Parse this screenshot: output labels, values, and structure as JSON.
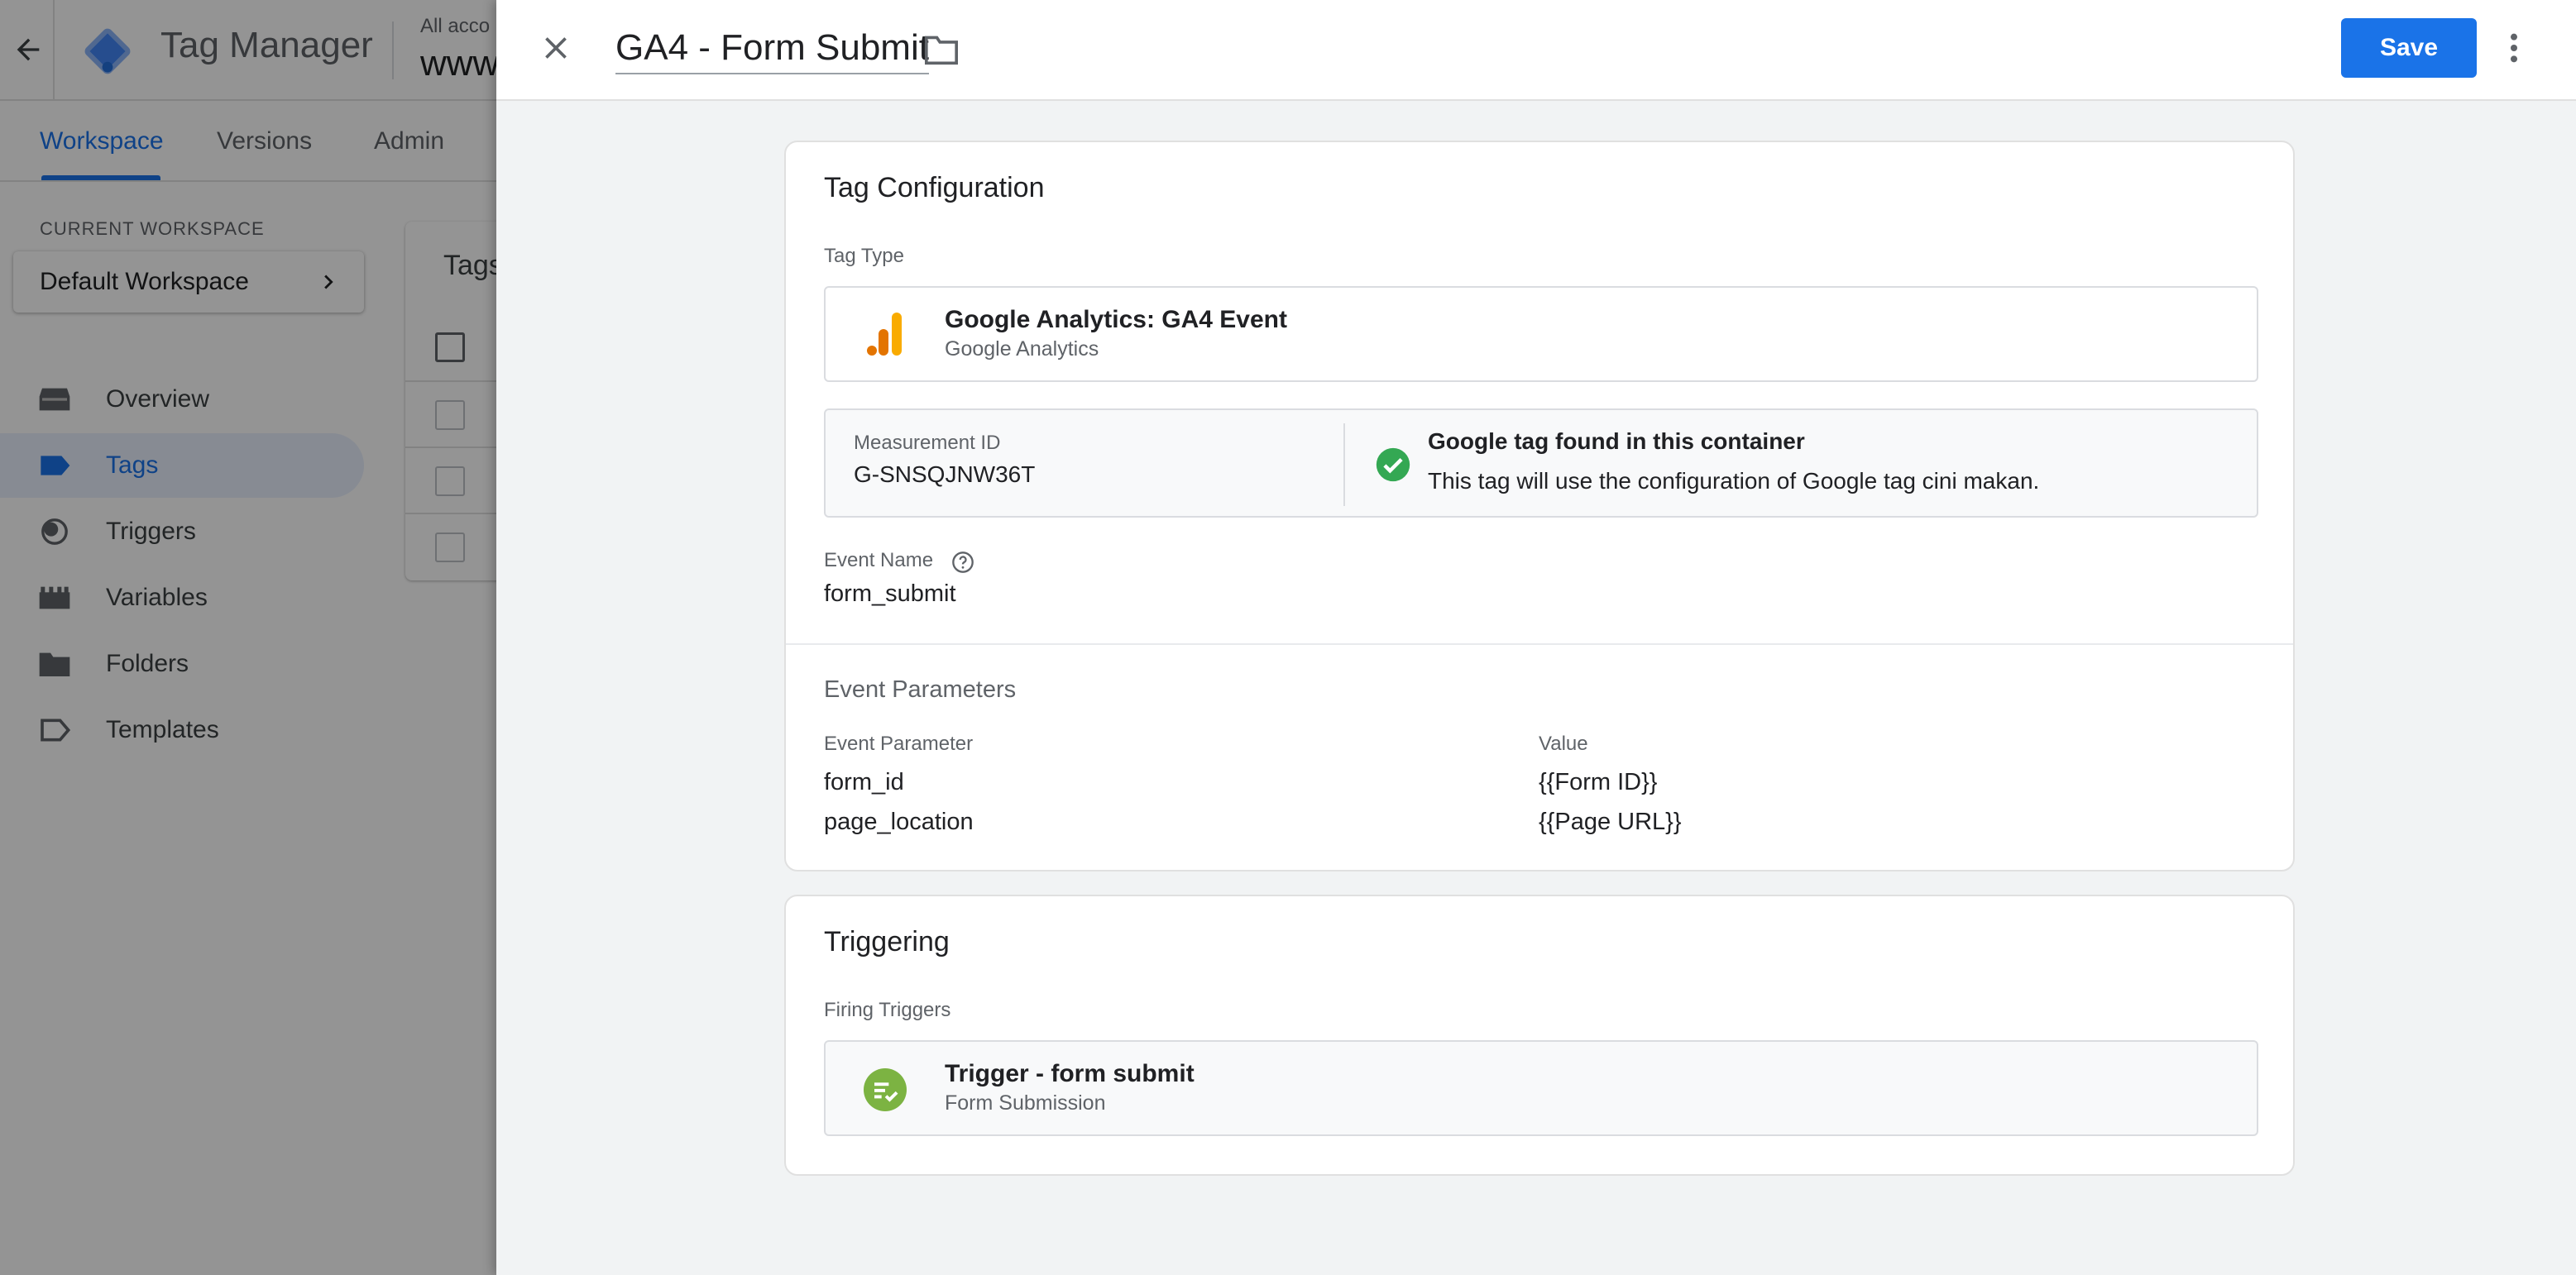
{
  "app": {
    "name": "Tag Manager",
    "account_small": "All acco",
    "account_big": "www",
    "tabs": [
      {
        "label": "Workspace"
      },
      {
        "label": "Versions"
      },
      {
        "label": "Admin"
      }
    ],
    "current_workspace_label": "CURRENT WORKSPACE",
    "workspace_name": "Default Workspace",
    "sidebar": [
      {
        "label": "Overview",
        "icon": "overview-icon"
      },
      {
        "label": "Tags",
        "icon": "tag-icon"
      },
      {
        "label": "Triggers",
        "icon": "trigger-icon"
      },
      {
        "label": "Variables",
        "icon": "variables-icon"
      },
      {
        "label": "Folders",
        "icon": "folder-icon"
      },
      {
        "label": "Templates",
        "icon": "templates-icon"
      }
    ],
    "tags_card_title": "Tags"
  },
  "drawer": {
    "tag_name": "GA4 - Form Submit",
    "save_label": "Save",
    "config": {
      "title": "Tag Configuration",
      "tag_type_label": "Tag Type",
      "tag_type_name": "Google Analytics: GA4 Event",
      "tag_type_sub": "Google Analytics",
      "measurement_label": "Measurement ID",
      "measurement_value": "G-SNSQJNW36T",
      "found_title": "Google tag found in this container",
      "found_desc": "This tag will use the configuration of Google tag cini makan.",
      "event_name_label": "Event Name",
      "event_name_value": "form_submit",
      "params_title": "Event Parameters",
      "col_param": "Event Parameter",
      "col_value": "Value",
      "params": [
        {
          "name": "form_id",
          "value": "{{Form ID}}"
        },
        {
          "name": "page_location",
          "value": "{{Page URL}}"
        }
      ]
    },
    "triggering": {
      "title": "Triggering",
      "firing_label": "Firing Triggers",
      "trigger_name": "Trigger - form submit",
      "trigger_type": "Form Submission"
    }
  },
  "colors": {
    "accent": "#1a73e8",
    "success": "#34a853",
    "trigger_green": "#7cb342",
    "ga_orange": "#f9ab00",
    "ga_dark_orange": "#e37400"
  }
}
